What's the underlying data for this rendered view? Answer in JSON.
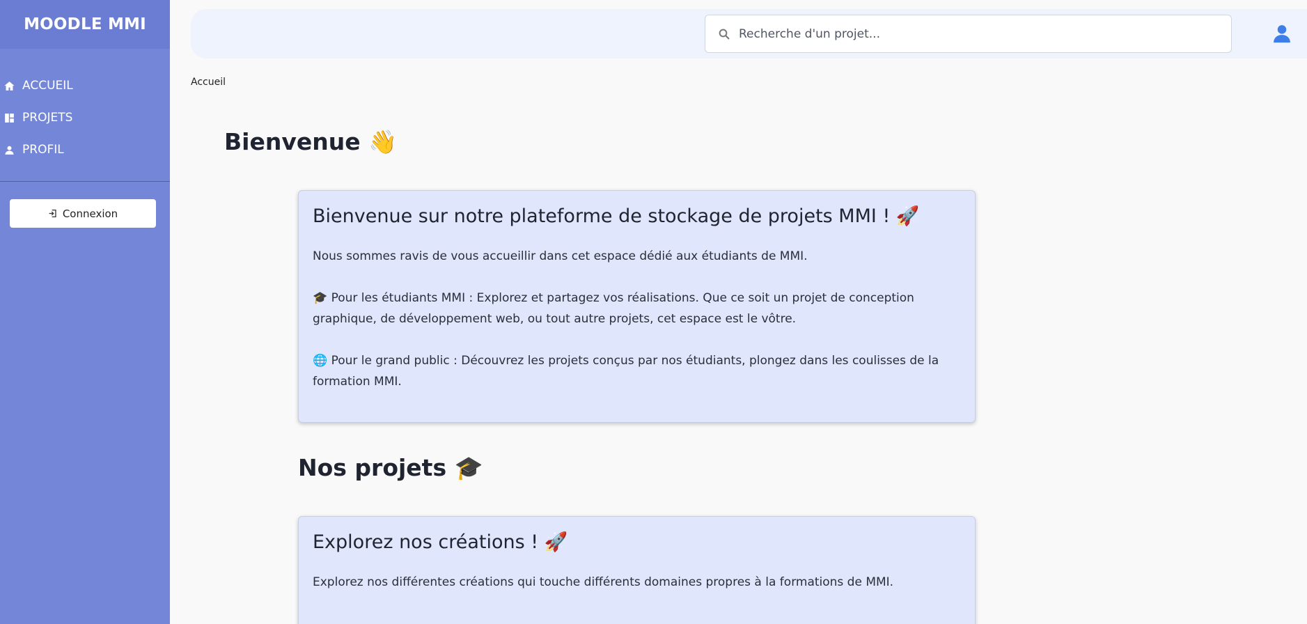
{
  "sidebar": {
    "brand": "MOODLE MMI",
    "items": [
      {
        "label": "ACCUEIL",
        "icon": "home-icon"
      },
      {
        "label": "PROJETS",
        "icon": "dashboard-icon"
      },
      {
        "label": "PROFIL",
        "icon": "person-icon"
      }
    ],
    "login_label": "Connexion"
  },
  "topbar": {
    "search_placeholder": "Recherche d'un projet..."
  },
  "breadcrumb": "Accueil",
  "welcome": {
    "title": "Bienvenue 👋"
  },
  "intro_card": {
    "title": "Bienvenue sur notre plateforme de stockage de projets MMI ! 🚀",
    "paragraphs": [
      "Nous sommes ravis de vous accueillir dans cet espace dédié aux étudiants de MMI.",
      "🎓 Pour les étudiants MMI : Explorez et partagez vos réalisations. Que ce soit un projet de conception graphique, de développement web, ou tout autre projets, cet espace est le vôtre.",
      "🌐 Pour le grand public : Découvrez les projets conçus par nos étudiants, plongez dans les coulisses de la formation MMI."
    ]
  },
  "projects_section": {
    "title": "Nos projets 🎓"
  },
  "projects_card": {
    "title": "Explorez nos créations ! 🚀",
    "paragraphs": [
      "Explorez nos différentes créations qui touche différents domaines propres à la formations de MMI."
    ]
  },
  "colors": {
    "sidebar": "#7486d8",
    "brand_bar": "#6b7dd3",
    "topbar": "#eef3fe",
    "card": "#e0e6fc",
    "user_icon": "#3f7de8"
  }
}
